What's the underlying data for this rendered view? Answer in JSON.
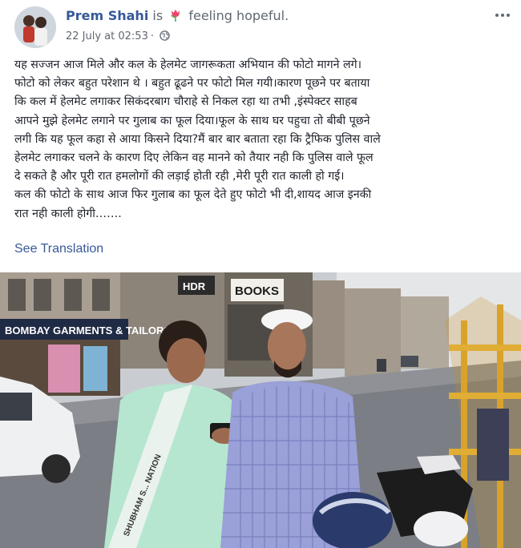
{
  "post": {
    "author": "Prem Shahi",
    "feeling_prefix": "is",
    "feeling_icon": "tulip-icon",
    "feeling_text": "feeling hopeful.",
    "timestamp": "22 July at 02:53",
    "privacy_icon": "globe-icon",
    "more_icon": "ellipsis-icon",
    "text_lines": [
      "यह सज्जन आज मिले और कल के हेलमेट जागरूकता अभियान की फोटो मागने लगे।",
      "फोटो को लेकर बहुत परेशान थे । बहुत ढूढने पर फोटो मिल गयी।कारण पूछने पर बताया",
      "कि कल में हेलमेट लगाकर सिकंदरबाग चौराहे से निकल रहा था तभी ,इंस्पेक्टर साहब",
      "आपने मुझे हेलमेट लगाने पर गुलाब का फूल दिया।फूल के साथ घर पहुचा तो बीबी पूछने",
      "लगी कि यह फूल कहा से आया किसने दिया?मैं बार बार बताता रहा कि ट्रैफिक पुलिस वाले",
      "हेलमेट लगाकर चलने के कारण दिए लेकिन वह मानने को तैयार नही कि पुलिस वाले फूल",
      "दे सकते है और पूरी रात हमलोगों की लड़ाई होती रही ,मेरी पूरी रात काली हो गई।",
      "कल की फोटो के साथ आज फिर गुलाब का फूल देते हुए फोटो भी दी,शायद आज इनकी",
      "रात नही काली होगी……."
    ],
    "see_translation": "See Translation"
  },
  "photo": {
    "signs": {
      "garments": "BOMBAY GARMENTS & TAILORS",
      "books": "BOOKS",
      "hdr": "HDR",
      "sash": "SHUBHAM S... NATION"
    }
  }
}
